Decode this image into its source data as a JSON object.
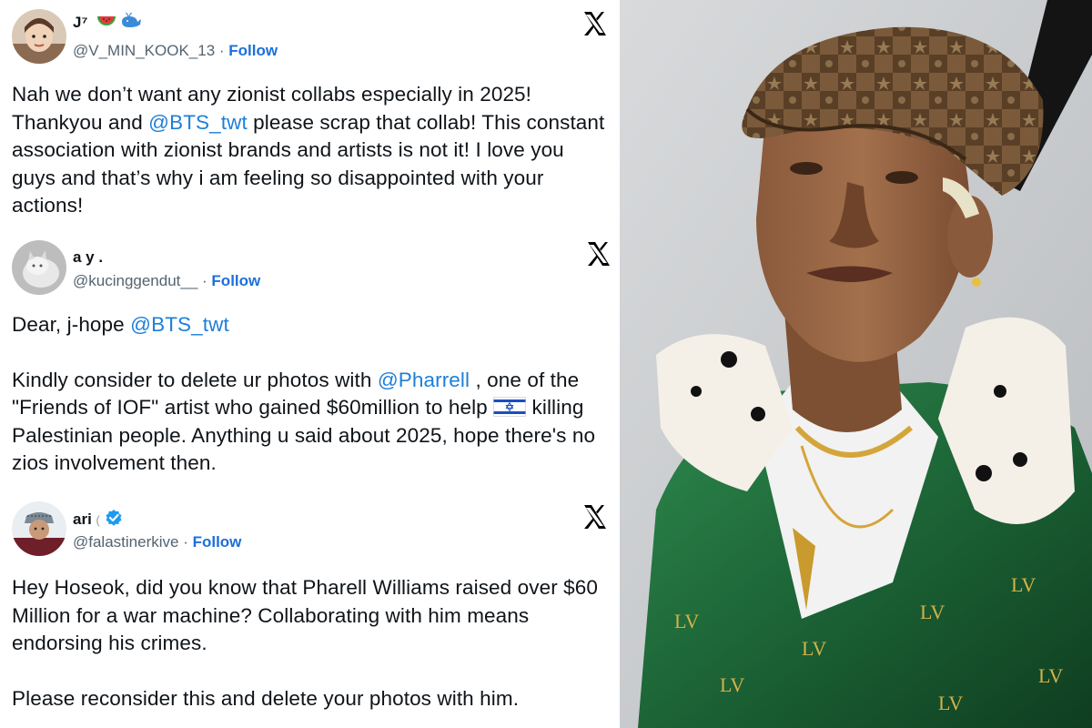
{
  "tweets": [
    {
      "display_name": "J⁷",
      "emojis": [
        "watermelon-icon",
        "whale-icon"
      ],
      "handle": "@V_MIN_KOOK_13",
      "separator": " · ",
      "follow": "Follow",
      "paragraphs": [
        [
          {
            "text": "Nah we don’t want any zionist collabs especially in 2025! Thankyou and "
          },
          {
            "text": "@BTS_twt",
            "mention": true
          },
          {
            "text": " please scrap that collab! This constant association with zionist brands and artists is not it! I love you guys and that’s why i am feeling so disappointed with your actions!"
          }
        ]
      ]
    },
    {
      "display_name": "a y .",
      "handle": "@kucinggendut__",
      "separator": " · ",
      "follow": "Follow",
      "paragraphs": [
        [
          {
            "text": "Dear, j-hope "
          },
          {
            "text": "@BTS_twt",
            "mention": true
          }
        ],
        [
          {
            "text": "Kindly consider to delete ur photos with "
          },
          {
            "text": "@Pharrell",
            "mention": true
          },
          {
            "text": " , one of the \"Friends of IOF\" artist who gained $60million to help "
          },
          {
            "flag": "israel-flag-icon"
          },
          {
            "text": " killing Palestinian people. Anything u said about 2025, hope there's no zios involvement then."
          }
        ]
      ]
    },
    {
      "display_name": "ari",
      "name_suffix": "(",
      "verified": "verified-badge-icon",
      "handle": "@falastinerkive",
      "separator": " · ",
      "follow": "Follow",
      "paragraphs": [
        [
          {
            "text": "Hey Hoseok, did you know that Pharell Williams raised over $60 Million for a war machine? Collaborating with him means endorsing his crimes."
          }
        ],
        [
          {
            "text": "Please reconsider this and delete your photos with him."
          }
        ]
      ]
    }
  ],
  "icons": {
    "x_logo": "x-logo-icon"
  },
  "colors": {
    "text": "#0f1419",
    "handle": "#536471",
    "follow": "#1d6fd9",
    "mention": "#1d7fd9",
    "jacket_green": "#1f6b3a"
  },
  "photo": {
    "subject": "man in monogram cap and green velvet jacket with white fur collar"
  }
}
